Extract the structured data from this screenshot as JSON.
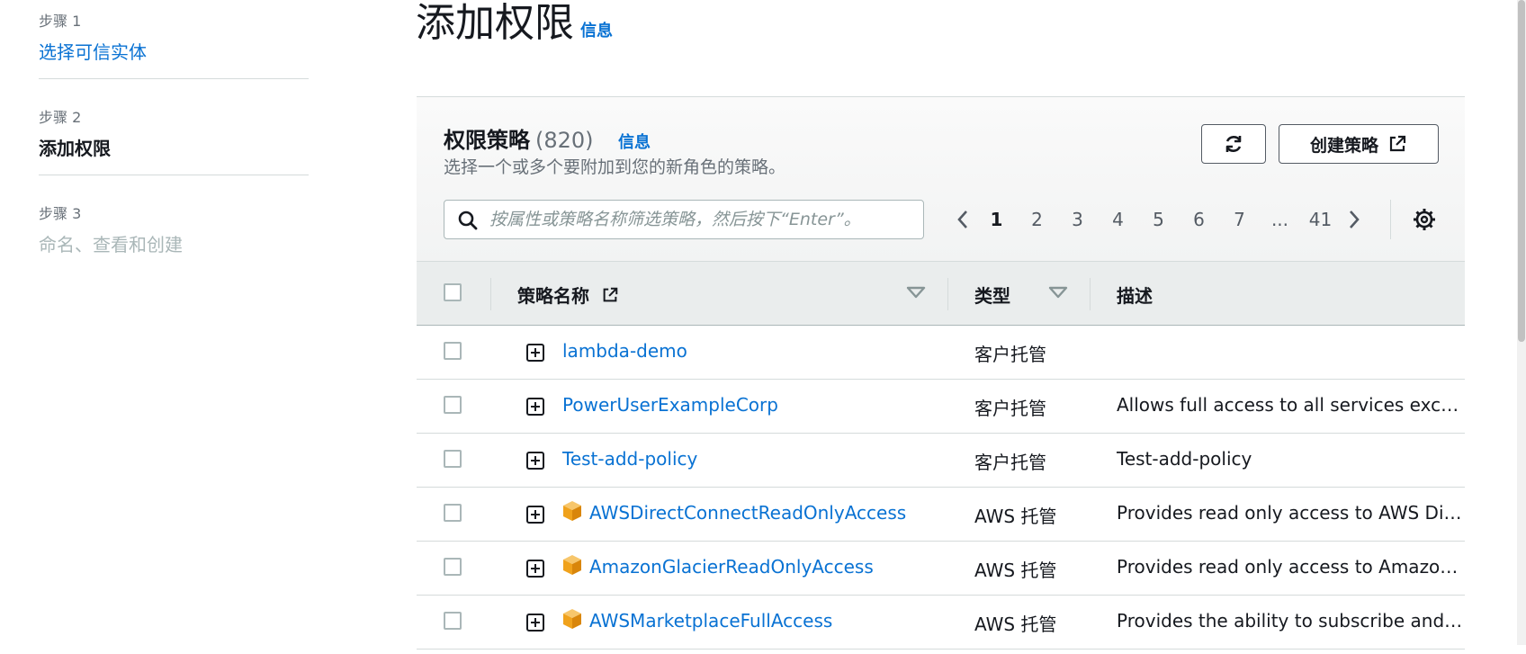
{
  "steps": [
    {
      "number": "步骤 1",
      "title": "选择可信实体",
      "state": "link"
    },
    {
      "number": "步骤 2",
      "title": "添加权限",
      "state": "current"
    },
    {
      "number": "步骤 3",
      "title": "命名、查看和创建",
      "state": "disabled"
    }
  ],
  "header": {
    "title": "添加权限",
    "info": "信息"
  },
  "policies": {
    "title": "权限策略",
    "count": "(820)",
    "info": "信息",
    "description": "选择一个或多个要附加到您的新角色的策略。",
    "refresh_icon": "refresh-icon",
    "create_label": "创建策略",
    "external_icon": "external-link-icon",
    "search_placeholder": "按属性或策略名称筛选策略，然后按下“Enter”。",
    "search_value": "",
    "pagination": {
      "pages": [
        "1",
        "2",
        "3",
        "4",
        "5",
        "6",
        "7",
        "...",
        "41"
      ],
      "current": "1"
    },
    "columns": {
      "name": "策略名称",
      "type": "类型",
      "description": "描述"
    },
    "rows": [
      {
        "name": "lambda-demo",
        "type": "客户托管",
        "description": "",
        "aws_managed": false
      },
      {
        "name": "PowerUserExampleCorp",
        "type": "客户托管",
        "description": "Allows full access to all services except for IAM",
        "aws_managed": false
      },
      {
        "name": "Test-add-policy",
        "type": "客户托管",
        "description": "Test-add-policy",
        "aws_managed": false
      },
      {
        "name": "AWSDirectConnectReadOnlyAccess",
        "type": "AWS 托管",
        "description": "Provides read only access to AWS Direct Connect via the AWS Management Console.",
        "aws_managed": true
      },
      {
        "name": "AmazonGlacierReadOnlyAccess",
        "type": "AWS 托管",
        "description": "Provides read only access to Amazon Glacier via the AWS Management Console.",
        "aws_managed": true
      },
      {
        "name": "AWSMarketplaceFullAccess",
        "type": "AWS 托管",
        "description": "Provides the ability to subscribe and unsubscribe to AWS Marketplace software.",
        "aws_managed": true
      }
    ]
  },
  "colors": {
    "link": "#0972d3",
    "aws_icon": "#f0a21c"
  }
}
